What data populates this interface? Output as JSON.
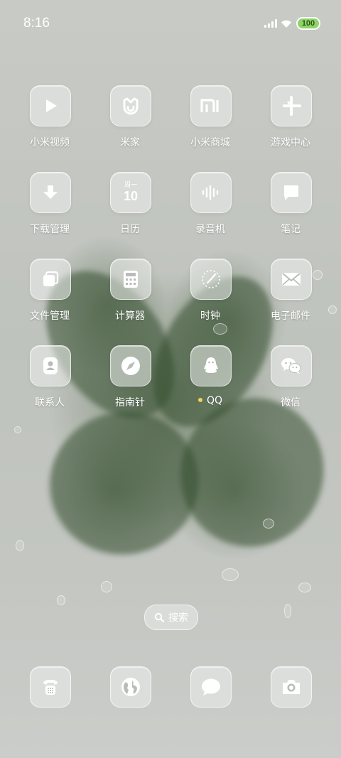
{
  "status_bar": {
    "time": "8:16",
    "battery": "100",
    "battery_color": "#8fd36a"
  },
  "apps": [
    {
      "label": "小米视频",
      "icon": "play-icon"
    },
    {
      "label": "米家",
      "icon": "mijia-icon"
    },
    {
      "label": "小米商城",
      "icon": "mi-logo-icon"
    },
    {
      "label": "游戏中心",
      "icon": "game-center-icon"
    },
    {
      "label": "下载管理",
      "icon": "download-icon"
    },
    {
      "label": "日历",
      "icon": "calendar-icon",
      "calendar_weekday": "周一",
      "calendar_day": "10"
    },
    {
      "label": "录音机",
      "icon": "recorder-icon"
    },
    {
      "label": "笔记",
      "icon": "notes-icon"
    },
    {
      "label": "文件管理",
      "icon": "file-manager-icon"
    },
    {
      "label": "计算器",
      "icon": "calculator-icon"
    },
    {
      "label": "时钟",
      "icon": "clock-icon"
    },
    {
      "label": "电子邮件",
      "icon": "mail-icon"
    },
    {
      "label": "联系人",
      "icon": "contacts-icon"
    },
    {
      "label": "指南针",
      "icon": "compass-icon"
    },
    {
      "label": "QQ",
      "icon": "qq-icon",
      "new_indicator_color": "#f2cf62"
    },
    {
      "label": "微信",
      "icon": "wechat-icon"
    }
  ],
  "search": {
    "label": "搜索",
    "icon": "search-icon"
  },
  "dock": [
    {
      "icon": "phone-icon"
    },
    {
      "icon": "browser-icon"
    },
    {
      "icon": "messages-icon"
    },
    {
      "icon": "camera-icon"
    }
  ]
}
